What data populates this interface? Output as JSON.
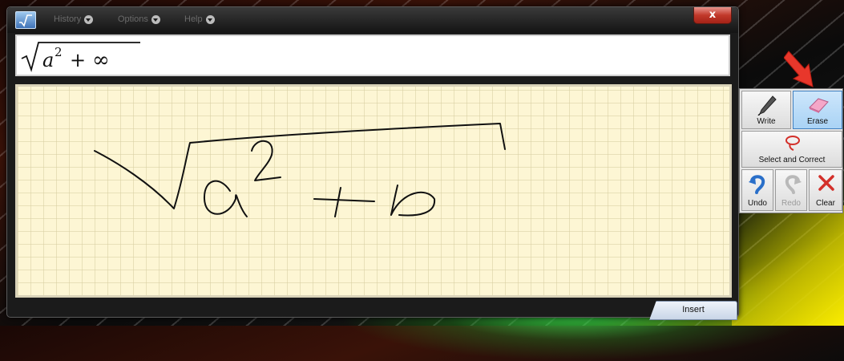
{
  "window": {
    "menus": [
      {
        "label": "History"
      },
      {
        "label": "Options"
      },
      {
        "label": "Help"
      }
    ],
    "close_symbol": "x"
  },
  "preview": {
    "formula_text": "√(a² + ∞)",
    "base": "a",
    "exponent": "2",
    "operator": "+",
    "term": "∞"
  },
  "toolbox": {
    "write_label": "Write",
    "erase_label": "Erase",
    "select_correct_label": "Select and Correct",
    "undo_label": "Undo",
    "redo_label": "Redo",
    "clear_label": "Clear",
    "active_tool": "Erase"
  },
  "insert_label": "Insert",
  "colors": {
    "writing_pad": "#fdf6d4",
    "ink": "#111111",
    "arrow": "#e8372b",
    "active_tool": "#a9d3f5"
  },
  "icons": [
    "math-input-app-icon",
    "pen-icon",
    "eraser-icon",
    "lasso-icon",
    "undo-icon",
    "redo-icon",
    "clear-x-icon",
    "red-arrow-icon"
  ]
}
